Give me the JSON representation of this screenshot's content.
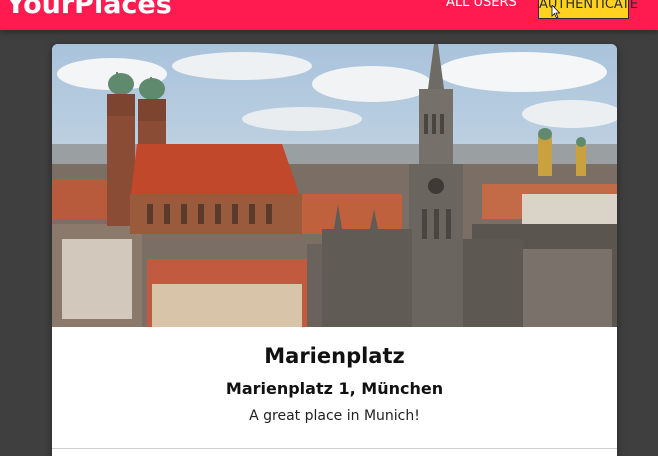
{
  "header": {
    "logo": "YourPlaces",
    "nav_all_users": "ALL USERS",
    "authenticate_label": "AUTHENTICATE",
    "background_color": "#ff1a50",
    "button_color": "#ffd21f"
  },
  "place": {
    "title": "Marienplatz",
    "address": "Marienplatz 1, München",
    "description": "A great place in Munich!"
  },
  "icons": {
    "cursor": "mouse-pointer-icon"
  }
}
